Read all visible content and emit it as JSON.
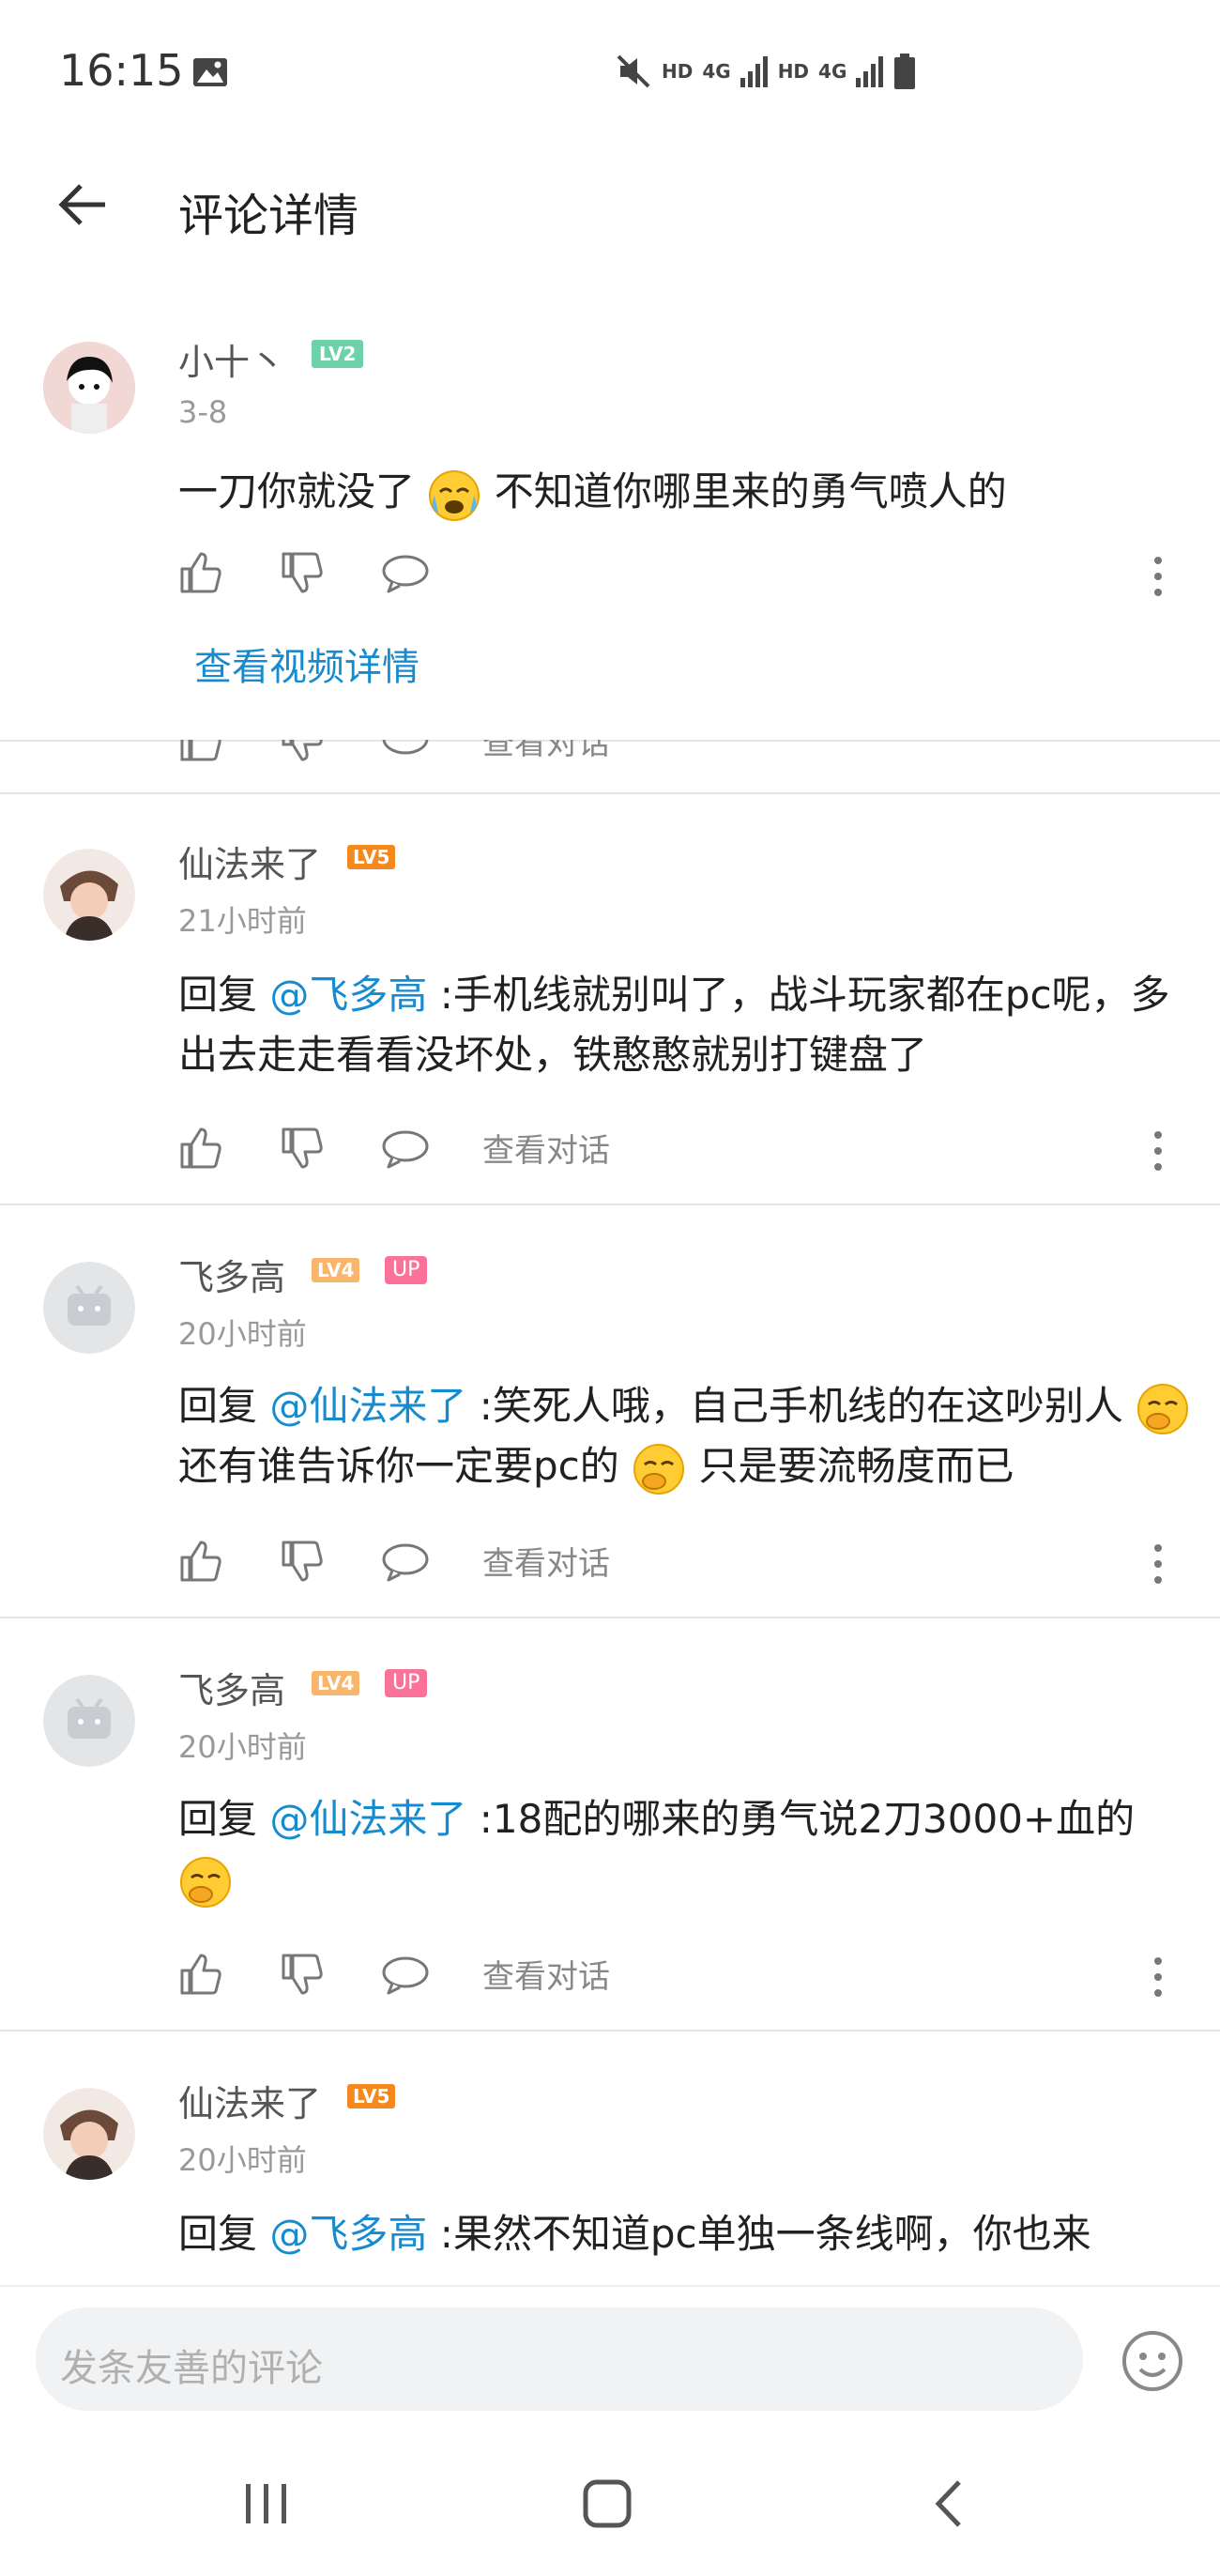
{
  "status_bar": {
    "time": "16:15",
    "net1": "HD",
    "net2": "4G",
    "net3": "HD",
    "net4": "4G"
  },
  "header": {
    "title": "评论详情"
  },
  "top_comment": {
    "username": "小十丶",
    "level": "LV2",
    "time": "3-8",
    "text_before_emoji": "一刀你就没了",
    "text_after_emoji": "不知道你哪里来的勇气喷人的",
    "view_video_label": "查看视频详情"
  },
  "cut_row": {
    "view_convo": "查看对话"
  },
  "replies": [
    {
      "username": "仙法来了",
      "level": "LV5",
      "up": "",
      "time": "21小时前",
      "reply_prefix": "回复 ",
      "mention": "@飞多高",
      "text": " :手机线就别叫了，战斗玩家都在pc呢，多出去走走看看没坏处，铁憨憨就别打键盘了",
      "view_convo": "查看对话"
    },
    {
      "username": "飞多高",
      "level": "LV4",
      "up": "UP",
      "time": "20小时前",
      "reply_prefix": "回复 ",
      "mention": "@仙法来了",
      "text_1": " :笑死人哦，自己手机线的在这吵别人",
      "text_2": "还有谁告诉你一定要pc的",
      "text_3": "只是要流畅度而已",
      "view_convo": "查看对话"
    },
    {
      "username": "飞多高",
      "level": "LV4",
      "up": "UP",
      "time": "20小时前",
      "reply_prefix": "回复 ",
      "mention": "@仙法来了",
      "text": " :18配的哪来的勇气说2刀3000+血的",
      "view_convo": "查看对话"
    },
    {
      "username": "仙法来了",
      "level": "LV5",
      "up": "",
      "time": "20小时前",
      "reply_prefix": "回复 ",
      "mention": "@飞多高",
      "text": " :果然不知道pc单独一条线啊，你也来"
    }
  ],
  "input": {
    "placeholder": "发条友善的评论"
  },
  "colors": {
    "accent": "#178bcf",
    "pink": "#fb7299",
    "orange": "#f48a1f"
  }
}
